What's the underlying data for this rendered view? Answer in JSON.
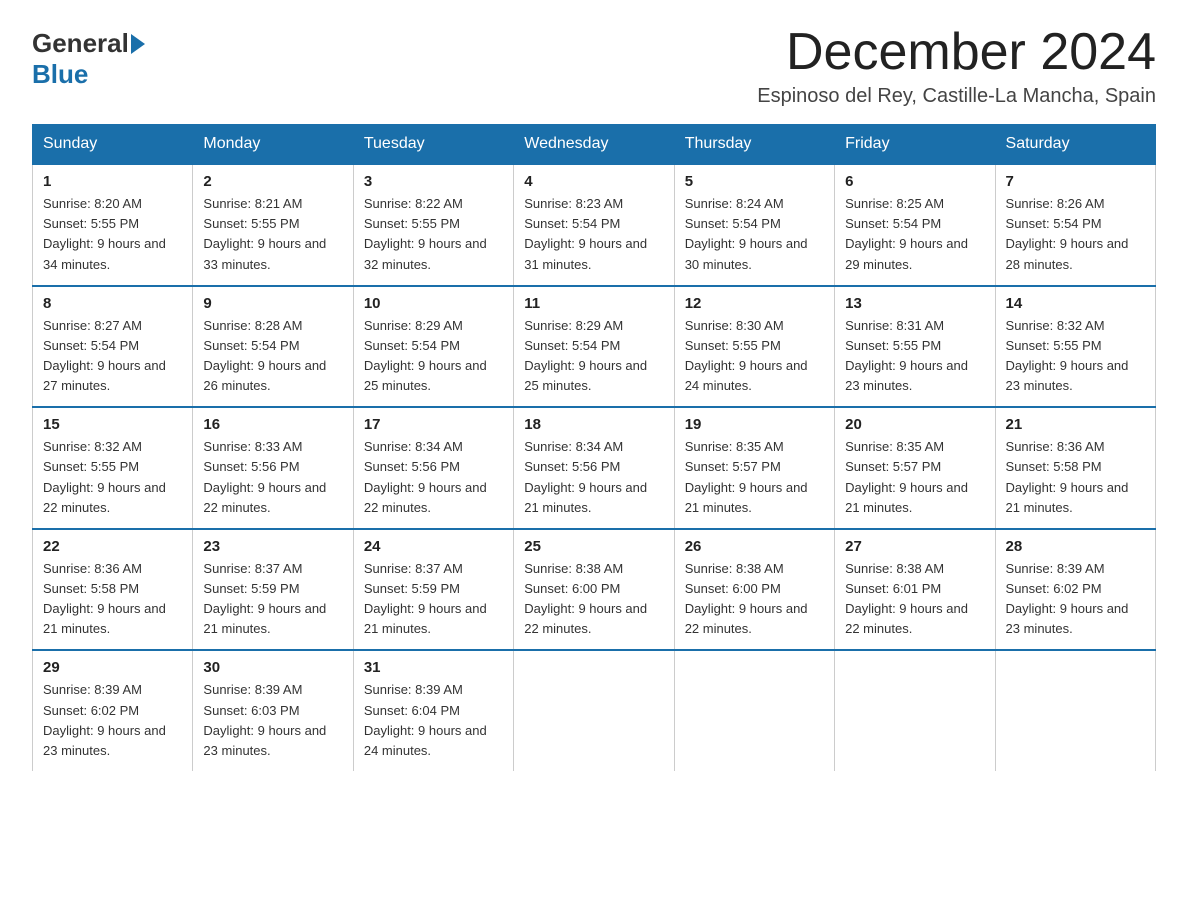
{
  "logo": {
    "general": "General",
    "blue": "Blue"
  },
  "title": "December 2024",
  "location": "Espinoso del Rey, Castille-La Mancha, Spain",
  "days_of_week": [
    "Sunday",
    "Monday",
    "Tuesday",
    "Wednesday",
    "Thursday",
    "Friday",
    "Saturday"
  ],
  "weeks": [
    [
      {
        "day": "1",
        "sunrise": "8:20 AM",
        "sunset": "5:55 PM",
        "daylight": "9 hours and 34 minutes."
      },
      {
        "day": "2",
        "sunrise": "8:21 AM",
        "sunset": "5:55 PM",
        "daylight": "9 hours and 33 minutes."
      },
      {
        "day": "3",
        "sunrise": "8:22 AM",
        "sunset": "5:55 PM",
        "daylight": "9 hours and 32 minutes."
      },
      {
        "day": "4",
        "sunrise": "8:23 AM",
        "sunset": "5:54 PM",
        "daylight": "9 hours and 31 minutes."
      },
      {
        "day": "5",
        "sunrise": "8:24 AM",
        "sunset": "5:54 PM",
        "daylight": "9 hours and 30 minutes."
      },
      {
        "day": "6",
        "sunrise": "8:25 AM",
        "sunset": "5:54 PM",
        "daylight": "9 hours and 29 minutes."
      },
      {
        "day": "7",
        "sunrise": "8:26 AM",
        "sunset": "5:54 PM",
        "daylight": "9 hours and 28 minutes."
      }
    ],
    [
      {
        "day": "8",
        "sunrise": "8:27 AM",
        "sunset": "5:54 PM",
        "daylight": "9 hours and 27 minutes."
      },
      {
        "day": "9",
        "sunrise": "8:28 AM",
        "sunset": "5:54 PM",
        "daylight": "9 hours and 26 minutes."
      },
      {
        "day": "10",
        "sunrise": "8:29 AM",
        "sunset": "5:54 PM",
        "daylight": "9 hours and 25 minutes."
      },
      {
        "day": "11",
        "sunrise": "8:29 AM",
        "sunset": "5:54 PM",
        "daylight": "9 hours and 25 minutes."
      },
      {
        "day": "12",
        "sunrise": "8:30 AM",
        "sunset": "5:55 PM",
        "daylight": "9 hours and 24 minutes."
      },
      {
        "day": "13",
        "sunrise": "8:31 AM",
        "sunset": "5:55 PM",
        "daylight": "9 hours and 23 minutes."
      },
      {
        "day": "14",
        "sunrise": "8:32 AM",
        "sunset": "5:55 PM",
        "daylight": "9 hours and 23 minutes."
      }
    ],
    [
      {
        "day": "15",
        "sunrise": "8:32 AM",
        "sunset": "5:55 PM",
        "daylight": "9 hours and 22 minutes."
      },
      {
        "day": "16",
        "sunrise": "8:33 AM",
        "sunset": "5:56 PM",
        "daylight": "9 hours and 22 minutes."
      },
      {
        "day": "17",
        "sunrise": "8:34 AM",
        "sunset": "5:56 PM",
        "daylight": "9 hours and 22 minutes."
      },
      {
        "day": "18",
        "sunrise": "8:34 AM",
        "sunset": "5:56 PM",
        "daylight": "9 hours and 21 minutes."
      },
      {
        "day": "19",
        "sunrise": "8:35 AM",
        "sunset": "5:57 PM",
        "daylight": "9 hours and 21 minutes."
      },
      {
        "day": "20",
        "sunrise": "8:35 AM",
        "sunset": "5:57 PM",
        "daylight": "9 hours and 21 minutes."
      },
      {
        "day": "21",
        "sunrise": "8:36 AM",
        "sunset": "5:58 PM",
        "daylight": "9 hours and 21 minutes."
      }
    ],
    [
      {
        "day": "22",
        "sunrise": "8:36 AM",
        "sunset": "5:58 PM",
        "daylight": "9 hours and 21 minutes."
      },
      {
        "day": "23",
        "sunrise": "8:37 AM",
        "sunset": "5:59 PM",
        "daylight": "9 hours and 21 minutes."
      },
      {
        "day": "24",
        "sunrise": "8:37 AM",
        "sunset": "5:59 PM",
        "daylight": "9 hours and 21 minutes."
      },
      {
        "day": "25",
        "sunrise": "8:38 AM",
        "sunset": "6:00 PM",
        "daylight": "9 hours and 22 minutes."
      },
      {
        "day": "26",
        "sunrise": "8:38 AM",
        "sunset": "6:00 PM",
        "daylight": "9 hours and 22 minutes."
      },
      {
        "day": "27",
        "sunrise": "8:38 AM",
        "sunset": "6:01 PM",
        "daylight": "9 hours and 22 minutes."
      },
      {
        "day": "28",
        "sunrise": "8:39 AM",
        "sunset": "6:02 PM",
        "daylight": "9 hours and 23 minutes."
      }
    ],
    [
      {
        "day": "29",
        "sunrise": "8:39 AM",
        "sunset": "6:02 PM",
        "daylight": "9 hours and 23 minutes."
      },
      {
        "day": "30",
        "sunrise": "8:39 AM",
        "sunset": "6:03 PM",
        "daylight": "9 hours and 23 minutes."
      },
      {
        "day": "31",
        "sunrise": "8:39 AM",
        "sunset": "6:04 PM",
        "daylight": "9 hours and 24 minutes."
      },
      null,
      null,
      null,
      null
    ]
  ]
}
